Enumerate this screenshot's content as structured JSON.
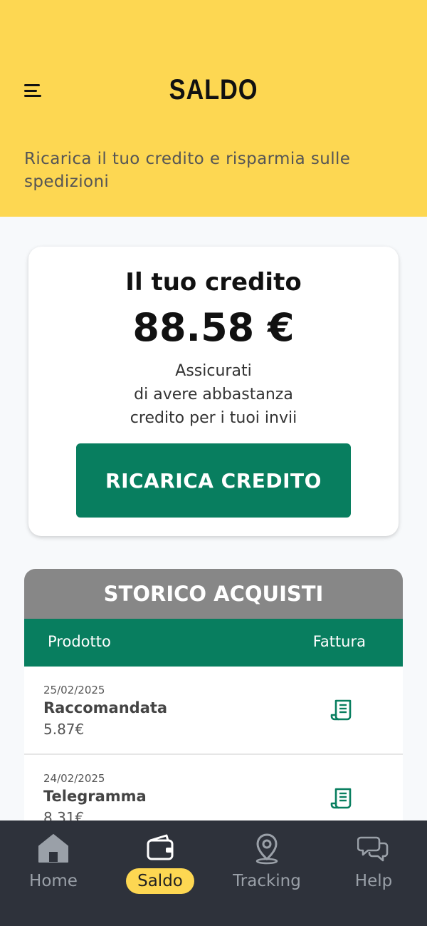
{
  "header": {
    "title": "SALDO",
    "subtitle": "Ricarica il tuo credito e risparmia sulle spedizioni",
    "menu_icon": "hamburger-menu-icon",
    "background": "#fdd752"
  },
  "credit": {
    "title": "Il tuo credito",
    "amount": "88.58 €",
    "note_lines": [
      "Assicurati",
      "di avere abbastanza",
      "credito per i tuoi invii"
    ],
    "button_label": "RICARICA CREDITO",
    "button_color": "#087e5f"
  },
  "history": {
    "title": "STORICO ACQUISTI",
    "col_product": "Prodotto",
    "col_invoice": "Fattura",
    "rows": [
      {
        "date": "25/02/2025",
        "product": "Raccomandata",
        "price": "5.87€",
        "icon": "invoice-icon"
      },
      {
        "date": "24/02/2025",
        "product": "Telegramma",
        "price": "8.31€",
        "icon": "invoice-icon"
      }
    ]
  },
  "tabs": [
    {
      "label": "Home",
      "icon": "home-icon",
      "active": false
    },
    {
      "label": "Saldo",
      "icon": "wallet-icon",
      "active": true
    },
    {
      "label": "Tracking",
      "icon": "map-pin-icon",
      "active": false
    },
    {
      "label": "Help",
      "icon": "chat-bubbles-icon",
      "active": false
    }
  ]
}
